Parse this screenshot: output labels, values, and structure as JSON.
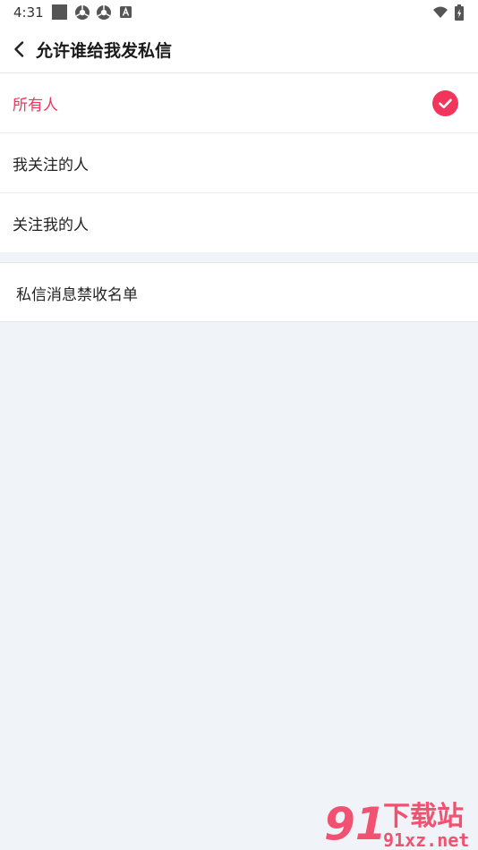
{
  "status_bar": {
    "time": "4:31",
    "icons": [
      "square-icon",
      "chrome-icon",
      "chrome-icon",
      "a-icon",
      "wifi-icon",
      "battery-icon"
    ]
  },
  "nav": {
    "title": "允许谁给我发私信",
    "back_icon": "chevron-left-icon"
  },
  "options": [
    {
      "label": "所有人",
      "selected": true
    },
    {
      "label": "我关注的人",
      "selected": false
    },
    {
      "label": "关注我的人",
      "selected": false
    }
  ],
  "blocklist": {
    "label": "私信消息禁收名单"
  },
  "watermark": {
    "brand_number": "91",
    "brand_text": "下载站",
    "domain": "91xz.net"
  },
  "colors": {
    "accent": "#f2355b",
    "background": "#f0f3f7",
    "surface": "#ffffff"
  }
}
